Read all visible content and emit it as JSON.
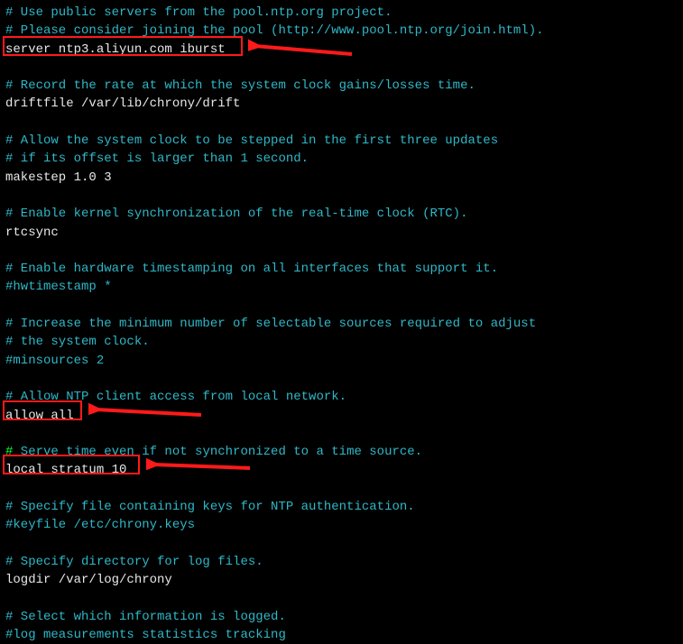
{
  "lines": {
    "l1": "# Use public servers from the pool.ntp.org project.",
    "l2": "# Please consider joining the pool (http://www.pool.ntp.org/join.html).",
    "l3": "server ntp3.aliyun.com iburst",
    "l4": "",
    "l5": "# Record the rate at which the system clock gains/losses time.",
    "l6": "driftfile /var/lib/chrony/drift",
    "l7": "",
    "l8": "# Allow the system clock to be stepped in the first three updates",
    "l9": "# if its offset is larger than 1 second.",
    "l10": "makestep 1.0 3",
    "l11": "",
    "l12": "# Enable kernel synchronization of the real-time clock (RTC).",
    "l13": "rtcsync",
    "l14": "",
    "l15": "# Enable hardware timestamping on all interfaces that support it.",
    "l16": "#hwtimestamp *",
    "l17": "",
    "l18": "# Increase the minimum number of selectable sources required to adjust",
    "l19": "# the system clock.",
    "l20": "#minsources 2",
    "l21": "",
    "l22": "# Allow NTP client access from local network.",
    "l23": "allow all",
    "l24": "",
    "l25": " Serve time even if not synchronized to a time source.",
    "l25hash": "#",
    "l26": "local stratum 10",
    "l27": "",
    "l28": "# Specify file containing keys for NTP authentication.",
    "l29": "#keyfile /etc/chrony.keys",
    "l30": "",
    "l31": "# Specify directory for log files.",
    "l32": "logdir /var/log/chrony",
    "l33": "",
    "l34": "# Select which information is logged.",
    "l35": "#log measurements statistics tracking"
  }
}
